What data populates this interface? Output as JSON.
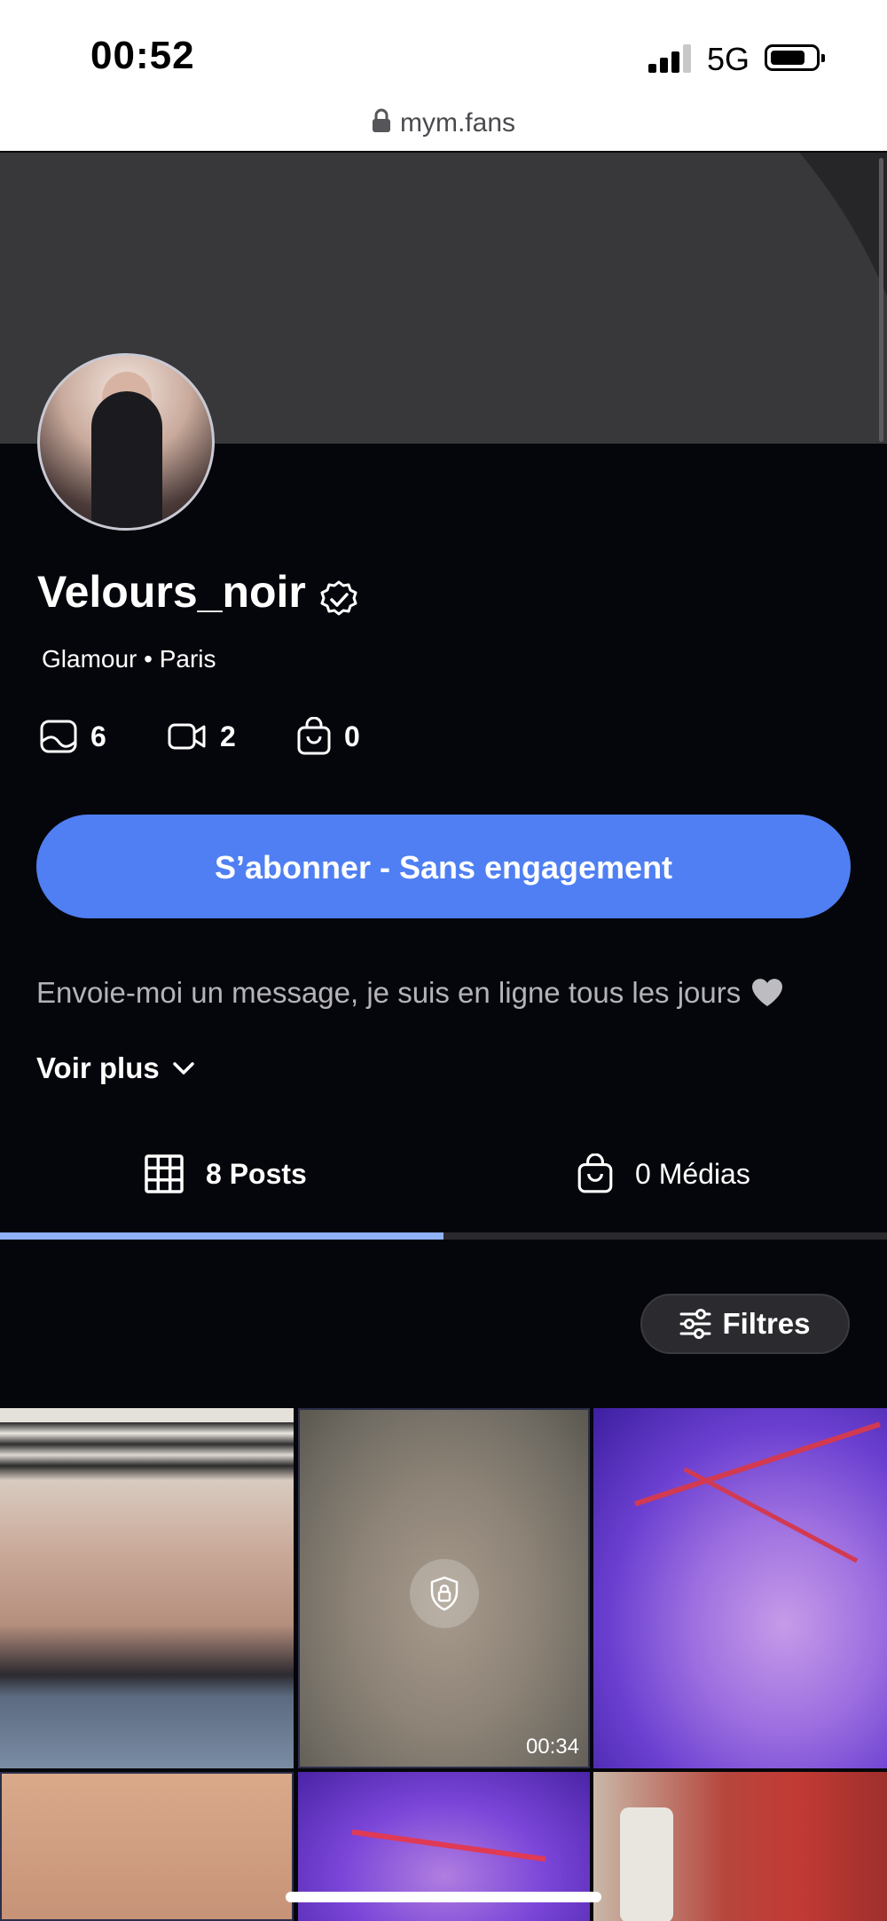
{
  "status_bar": {
    "time": "00:52",
    "network": "5G"
  },
  "browser": {
    "url": "mym.fans"
  },
  "profile": {
    "username": "Velours_noir",
    "subtitle": "Glamour • Paris",
    "stats": {
      "photos": "6",
      "videos": "2",
      "purchases": "0"
    },
    "subscribe_label": "S’abonner - Sans engagement",
    "bio": "Envoie-moi un message, je suis en ligne tous les jours",
    "see_more_label": "Voir plus"
  },
  "tabs": [
    {
      "label": "8 Posts",
      "selected": true
    },
    {
      "label": "0 Médias",
      "selected": false
    }
  ],
  "filters_label": "Filtres",
  "grid": [
    {
      "type": "photo",
      "locked": false
    },
    {
      "type": "video",
      "locked": true,
      "duration": "00:34"
    },
    {
      "type": "photo",
      "locked": false
    },
    {
      "type": "photo",
      "locked": false
    },
    {
      "type": "photo",
      "locked": false
    },
    {
      "type": "photo",
      "locked": false
    }
  ],
  "colors": {
    "accent": "#4f7ff2",
    "background": "#05060b",
    "tab_indicator": "#8fb1f5"
  }
}
